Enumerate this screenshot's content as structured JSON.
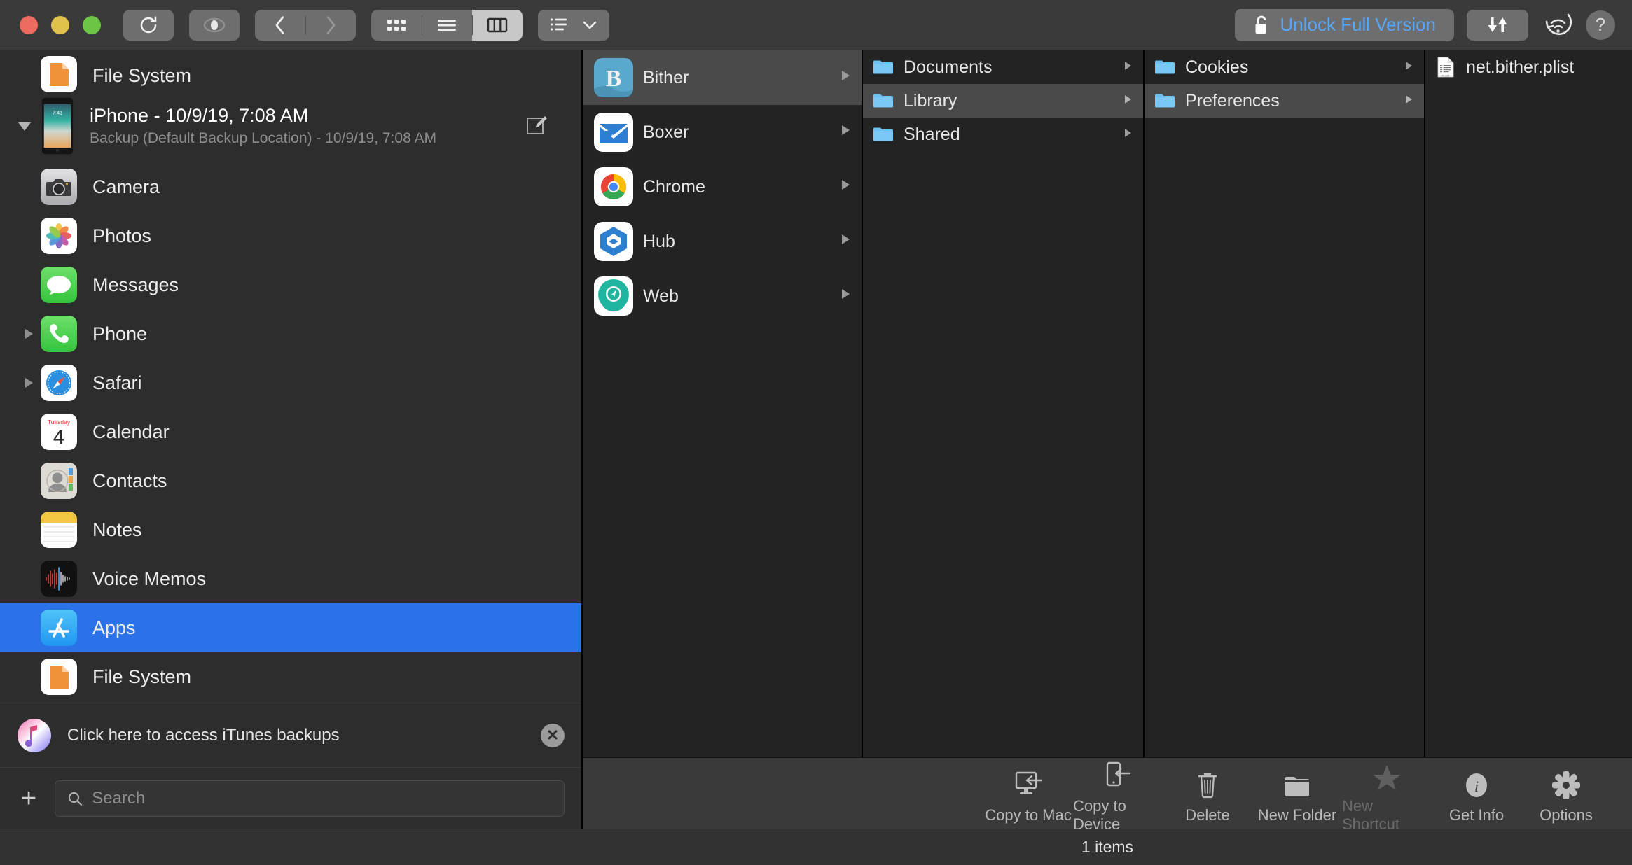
{
  "window": {
    "traffic_lights": [
      "close",
      "minimize",
      "zoom"
    ]
  },
  "toolbar": {
    "refresh_label": "refresh-icon",
    "preview_label": "eye-icon",
    "back_label": "back-chevron-icon",
    "forward_label": "forward-chevron-icon",
    "view_icon_label": "grid-view-icon",
    "view_list_label": "list-view-icon",
    "view_column_label": "column-view-icon",
    "arrange_label": "arrange-list-icon",
    "unlock_label": "Unlock Full Version",
    "transfer_label": "transfer-icon",
    "wifi_label": "wifi-sync-icon",
    "help_label": "?"
  },
  "sidebar": {
    "top_item": {
      "label": "File System",
      "icon": "file-system-icon"
    },
    "device": {
      "title": "iPhone - 10/9/19, 7:08 AM",
      "subtitle": "Backup (Default Backup Location) - 10/9/19, 7:08 AM",
      "expanded": true
    },
    "items": [
      {
        "label": "Camera",
        "icon": "camera-icon",
        "disclosure": false,
        "selected": false
      },
      {
        "label": "Photos",
        "icon": "photos-icon",
        "disclosure": false,
        "selected": false
      },
      {
        "label": "Messages",
        "icon": "messages-icon",
        "disclosure": false,
        "selected": false
      },
      {
        "label": "Phone",
        "icon": "phone-icon",
        "disclosure": true,
        "selected": false
      },
      {
        "label": "Safari",
        "icon": "safari-icon",
        "disclosure": true,
        "selected": false
      },
      {
        "label": "Calendar",
        "icon": "calendar-icon",
        "disclosure": false,
        "selected": false
      },
      {
        "label": "Contacts",
        "icon": "contacts-icon",
        "disclosure": false,
        "selected": false
      },
      {
        "label": "Notes",
        "icon": "notes-icon",
        "disclosure": false,
        "selected": false
      },
      {
        "label": "Voice Memos",
        "icon": "voice-memos-icon",
        "disclosure": false,
        "selected": false
      },
      {
        "label": "Apps",
        "icon": "apps-icon",
        "disclosure": false,
        "selected": true
      },
      {
        "label": "File System",
        "icon": "file-system-icon",
        "disclosure": false,
        "selected": false
      }
    ],
    "calendar_icon": {
      "weekday": "Tuesday",
      "day": "4"
    },
    "banner": {
      "text": "Click here to access iTunes backups",
      "close": "✕"
    },
    "add_button": "+",
    "search": {
      "placeholder": "Search",
      "value": ""
    }
  },
  "columns": [
    {
      "name": "apps-column",
      "rows": [
        {
          "label": "Bither",
          "icon": "bither-icon",
          "selected": true,
          "chevron": true
        },
        {
          "label": "Boxer",
          "icon": "boxer-icon",
          "selected": false,
          "chevron": true
        },
        {
          "label": "Chrome",
          "icon": "chrome-icon",
          "selected": false,
          "chevron": true
        },
        {
          "label": "Hub",
          "icon": "hub-icon",
          "selected": false,
          "chevron": true
        },
        {
          "label": "Web",
          "icon": "web-icon",
          "selected": false,
          "chevron": true
        }
      ]
    },
    {
      "name": "app-folders-column",
      "rows": [
        {
          "label": "Documents",
          "icon": "folder-icon",
          "selected": false,
          "chevron": true
        },
        {
          "label": "Library",
          "icon": "folder-icon",
          "selected": true,
          "chevron": true
        },
        {
          "label": "Shared",
          "icon": "folder-icon",
          "selected": false,
          "chevron": true
        }
      ]
    },
    {
      "name": "library-folders-column",
      "rows": [
        {
          "label": "Cookies",
          "icon": "folder-icon",
          "selected": false,
          "chevron": true
        },
        {
          "label": "Preferences",
          "icon": "folder-icon",
          "selected": true,
          "chevron": true
        }
      ]
    },
    {
      "name": "preferences-files-column",
      "rows": [
        {
          "label": "net.bither.plist",
          "icon": "plist-file-icon",
          "selected": false,
          "chevron": false
        }
      ]
    }
  ],
  "bottom_toolbar": [
    {
      "label": "Copy to Mac",
      "icon": "copy-to-mac-icon",
      "disabled": false
    },
    {
      "label": "Copy to Device",
      "icon": "copy-to-device-icon",
      "disabled": false
    },
    {
      "label": "Delete",
      "icon": "trash-icon",
      "disabled": false
    },
    {
      "label": "New Folder",
      "icon": "new-folder-icon",
      "disabled": false
    },
    {
      "label": "New Shortcut",
      "icon": "star-icon",
      "disabled": true
    },
    {
      "label": "Get Info",
      "icon": "info-icon",
      "disabled": false
    },
    {
      "label": "Options",
      "icon": "gear-icon",
      "disabled": false
    }
  ],
  "status": {
    "text": "1 items"
  },
  "colors": {
    "accent_selection": "#2b72e8",
    "link": "#58a6f7",
    "toolbar_bg": "#3a3a3a",
    "sidebar_bg": "#2d2d2d",
    "column_bg": "#232323",
    "column_selected": "#4a4a4a"
  }
}
